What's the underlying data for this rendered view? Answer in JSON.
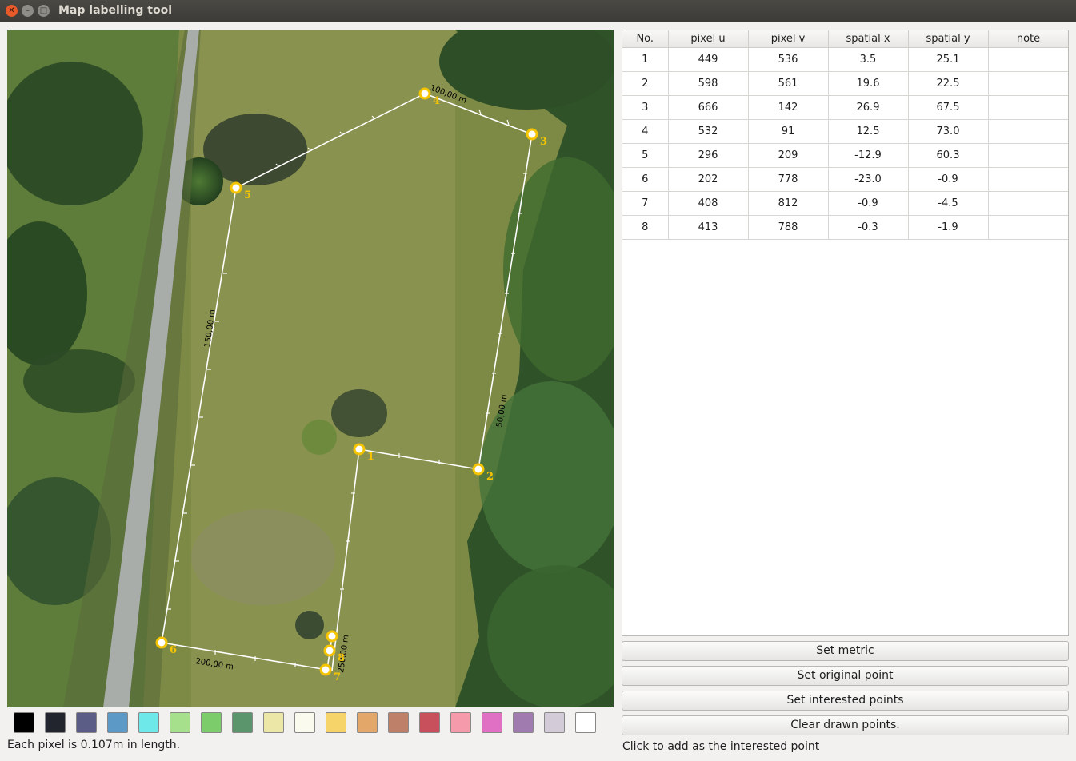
{
  "window": {
    "title": "Map labelling tool"
  },
  "map": {
    "edge_labels": [
      "100,00 m",
      "150,00 m",
      "50,00 m",
      "200,00 m",
      "250,00 m"
    ],
    "points": [
      {
        "label": "1"
      },
      {
        "label": "2"
      },
      {
        "label": "3"
      },
      {
        "label": "4"
      },
      {
        "label": "5"
      },
      {
        "label": "6"
      },
      {
        "label": "7"
      },
      {
        "label": "8"
      }
    ]
  },
  "table": {
    "headers": [
      "No.",
      "pixel u",
      "pixel v",
      "spatial x",
      "spatial y",
      "note"
    ],
    "rows": [
      [
        "1",
        "449",
        "536",
        "3.5",
        "25.1",
        ""
      ],
      [
        "2",
        "598",
        "561",
        "19.6",
        "22.5",
        ""
      ],
      [
        "3",
        "666",
        "142",
        "26.9",
        "67.5",
        ""
      ],
      [
        "4",
        "532",
        "91",
        "12.5",
        "73.0",
        ""
      ],
      [
        "5",
        "296",
        "209",
        "-12.9",
        "60.3",
        ""
      ],
      [
        "6",
        "202",
        "778",
        "-23.0",
        "-0.9",
        ""
      ],
      [
        "7",
        "408",
        "812",
        "-0.9",
        "-4.5",
        ""
      ],
      [
        "8",
        "413",
        "788",
        "-0.3",
        "-1.9",
        ""
      ]
    ]
  },
  "buttons": {
    "set_metric": "Set metric",
    "set_original": "Set original point",
    "set_interested": "Set interested points",
    "clear_drawn": "Clear drawn points."
  },
  "palette": [
    "#000000",
    "#22252e",
    "#5c5d86",
    "#5d99c6",
    "#6ee8e8",
    "#a6e08d",
    "#7ccc6b",
    "#5a956b",
    "#ece7a6",
    "#fbfaee",
    "#f7d46a",
    "#e3a76a",
    "#bf806a",
    "#c8505c",
    "#f49aaa",
    "#e070c4",
    "#a07bb0",
    "#d3ccd8",
    "#ffffff"
  ],
  "status": {
    "scale_text": "Each pixel is 0.107m in length.",
    "hint_text": "Click to add as the interested point"
  }
}
